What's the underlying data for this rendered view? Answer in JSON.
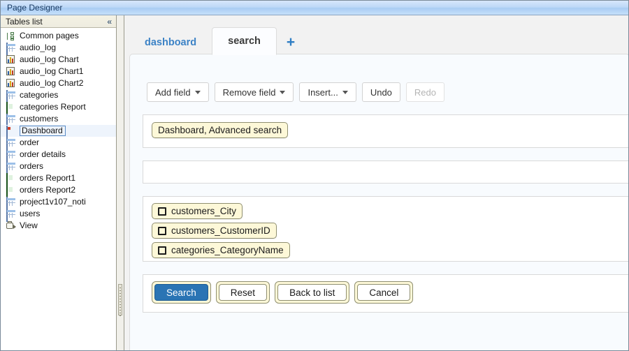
{
  "window": {
    "title": "Page Designer"
  },
  "sidebar": {
    "header": "Tables list",
    "collapse_icon": "«",
    "items": [
      {
        "label": "Common pages",
        "icon": "common-pages-icon",
        "selected": false
      },
      {
        "label": "audio_log",
        "icon": "table-icon",
        "selected": false
      },
      {
        "label": "audio_log Chart",
        "icon": "chart-icon",
        "selected": false
      },
      {
        "label": "audio_log Chart1",
        "icon": "chart-icon",
        "selected": false
      },
      {
        "label": "audio_log Chart2",
        "icon": "chart-icon",
        "selected": false
      },
      {
        "label": "categories",
        "icon": "table-icon",
        "selected": false
      },
      {
        "label": "categories Report",
        "icon": "report-icon",
        "selected": false
      },
      {
        "label": "customers",
        "icon": "table-icon",
        "selected": false
      },
      {
        "label": "Dashboard",
        "icon": "dashboard-icon",
        "selected": true
      },
      {
        "label": "order",
        "icon": "table-icon",
        "selected": false
      },
      {
        "label": "order details",
        "icon": "table-icon",
        "selected": false
      },
      {
        "label": "orders",
        "icon": "table-icon",
        "selected": false
      },
      {
        "label": "orders Report1",
        "icon": "report-icon",
        "selected": false
      },
      {
        "label": "orders Report2",
        "icon": "report-icon",
        "selected": false
      },
      {
        "label": "project1v107_noti",
        "icon": "table-icon",
        "selected": false
      },
      {
        "label": "users",
        "icon": "table-icon",
        "selected": false
      },
      {
        "label": "View",
        "icon": "view-icon",
        "selected": false
      }
    ]
  },
  "tabs": {
    "items": [
      {
        "label": "dashboard",
        "active": false
      },
      {
        "label": "search",
        "active": true
      }
    ],
    "add_label": "+"
  },
  "toolbar": {
    "buttons": [
      {
        "label": "Add field",
        "caret": true,
        "disabled": false
      },
      {
        "label": "Remove field",
        "caret": true,
        "disabled": false
      },
      {
        "label": "Insert...",
        "caret": true,
        "disabled": false
      },
      {
        "label": "Undo",
        "caret": false,
        "disabled": false
      },
      {
        "label": "Redo",
        "caret": false,
        "disabled": true
      }
    ]
  },
  "form": {
    "title_pill": "Dashboard, Advanced search",
    "empty_row": "",
    "fields": [
      "customers_City",
      "customers_CustomerID",
      "categories_CategoryName"
    ],
    "actions": [
      {
        "label": "Search",
        "primary": true
      },
      {
        "label": "Reset",
        "primary": false
      },
      {
        "label": "Back to list",
        "primary": false
      },
      {
        "label": "Cancel",
        "primary": false
      }
    ]
  },
  "colors": {
    "accent_blue": "#2a74b4",
    "tab_link": "#3d83c6",
    "pill_bg": "#fdf8d8",
    "pill_border": "#8f8f70",
    "titlebar": "#bcd8f7"
  }
}
